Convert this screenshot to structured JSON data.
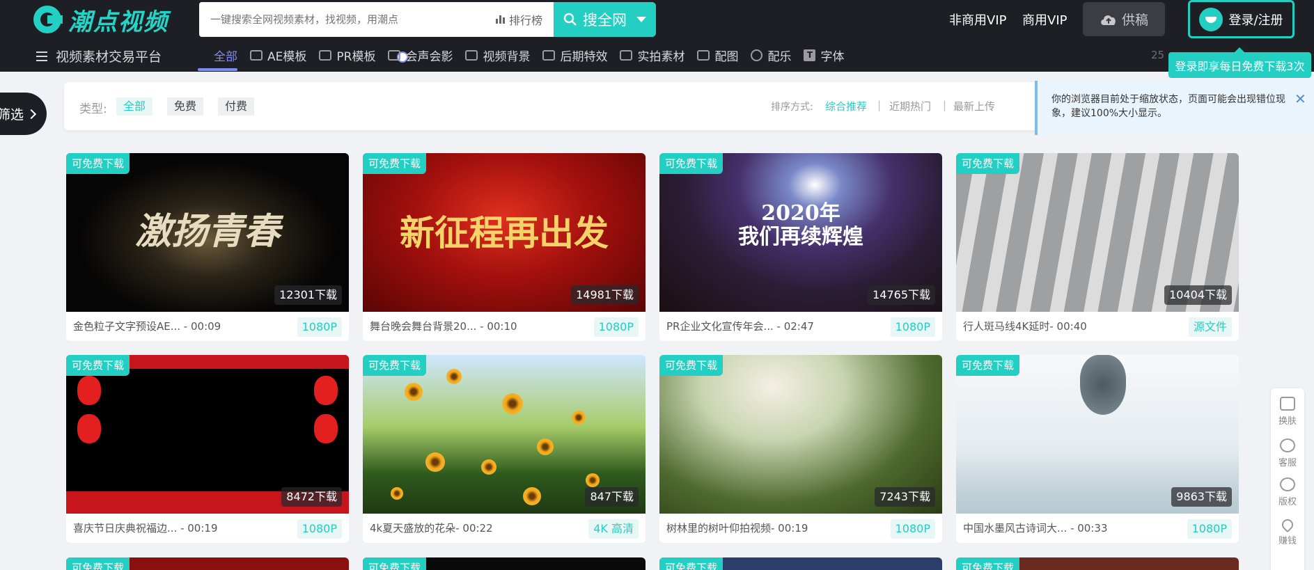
{
  "header": {
    "logo": "潮点视频",
    "search_placeholder": "一键搜索全网视频素材，找视频，用潮点",
    "rank_label": "排行榜",
    "search_button": "搜全网",
    "vip_noncommercial": "非商用VIP",
    "vip_commercial": "商用VIP",
    "supply_label": "供稿",
    "login_label": "登录/注册",
    "login_tip": "登录即享每日免费下载3次"
  },
  "nav": {
    "platform_label": "视频素材交易平台",
    "tabs": [
      {
        "label": "全部",
        "icon": "search-icon"
      },
      {
        "label": "AE模板",
        "icon": "ae-icon"
      },
      {
        "label": "PR模板",
        "icon": "pr-icon"
      },
      {
        "label": "会声会影",
        "icon": "vs-icon"
      },
      {
        "label": "视频背景",
        "icon": "image-icon"
      },
      {
        "label": "后期特效",
        "icon": "effects-icon"
      },
      {
        "label": "实拍素材",
        "icon": "camera-icon"
      },
      {
        "label": "配图",
        "icon": "picture-icon"
      },
      {
        "label": "配乐",
        "icon": "music-icon"
      },
      {
        "label": "字体",
        "icon": "font-icon"
      }
    ],
    "count_fragment": "25"
  },
  "side_filter": "筛选",
  "filter": {
    "type_label": "类型:",
    "chips": [
      "全部",
      "免费",
      "付费"
    ],
    "sort_label": "排序方式:",
    "sort_options": [
      "综合推荐",
      "近期热门",
      "最新上传"
    ]
  },
  "zoom_notice": {
    "text": "你的浏览器目前处于缩放状态，页面可能会出现错位现象，建议100%大小显示。",
    "close": "✕"
  },
  "cards": [
    {
      "badge": "可免费下载",
      "downloads": "12301下载",
      "title": "金色粒子文字预设AE... - 00:09",
      "resolution": "1080P",
      "art": "art-glitter",
      "art_text": "激扬青春"
    },
    {
      "badge": "可免费下载",
      "downloads": "14981下载",
      "title": "舞台晚会舞台背景20... - 00:10",
      "resolution": "1080P",
      "art": "art-red",
      "art_text": "新征程再出发"
    },
    {
      "badge": "可免费下载",
      "downloads": "14765下载",
      "title": "PR企业文化宣传年会... - 02:47",
      "resolution": "1080P",
      "art": "art-space",
      "art_text": "2020年\n我们再续辉煌"
    },
    {
      "badge": "可免费下载",
      "downloads": "10404下载",
      "title": "行人斑马线4K延时- 00:40",
      "resolution": "源文件",
      "art": "art-road",
      "art_text": ""
    },
    {
      "badge": "可免费下载",
      "downloads": "8472下载",
      "title": "喜庆节日庆典祝福边... - 00:19",
      "resolution": "1080P",
      "art": "art-lantern",
      "art_text": ""
    },
    {
      "badge": "可免费下载",
      "downloads": "847下载",
      "title": "4k夏天盛放的花朵- 00:22",
      "resolution": "4K 高清",
      "art": "art-flower",
      "art_text": ""
    },
    {
      "badge": "可免费下载",
      "downloads": "7243下载",
      "title": "树林里的树叶仰拍视频- 00:19",
      "resolution": "1080P",
      "art": "art-leaves",
      "art_text": ""
    },
    {
      "badge": "可免费下载",
      "downloads": "9863下载",
      "title": "中国水墨风古诗词大... - 00:33",
      "resolution": "1080P",
      "art": "art-ink",
      "art_text": ""
    }
  ],
  "peek_badge": "可免费下载",
  "right_bar": [
    "换肤",
    "客服",
    "版权",
    "赚钱"
  ],
  "colors": {
    "accent": "#22cfc2",
    "header_bg": "#1e1f24",
    "active_tab": "#7c8cf5"
  }
}
